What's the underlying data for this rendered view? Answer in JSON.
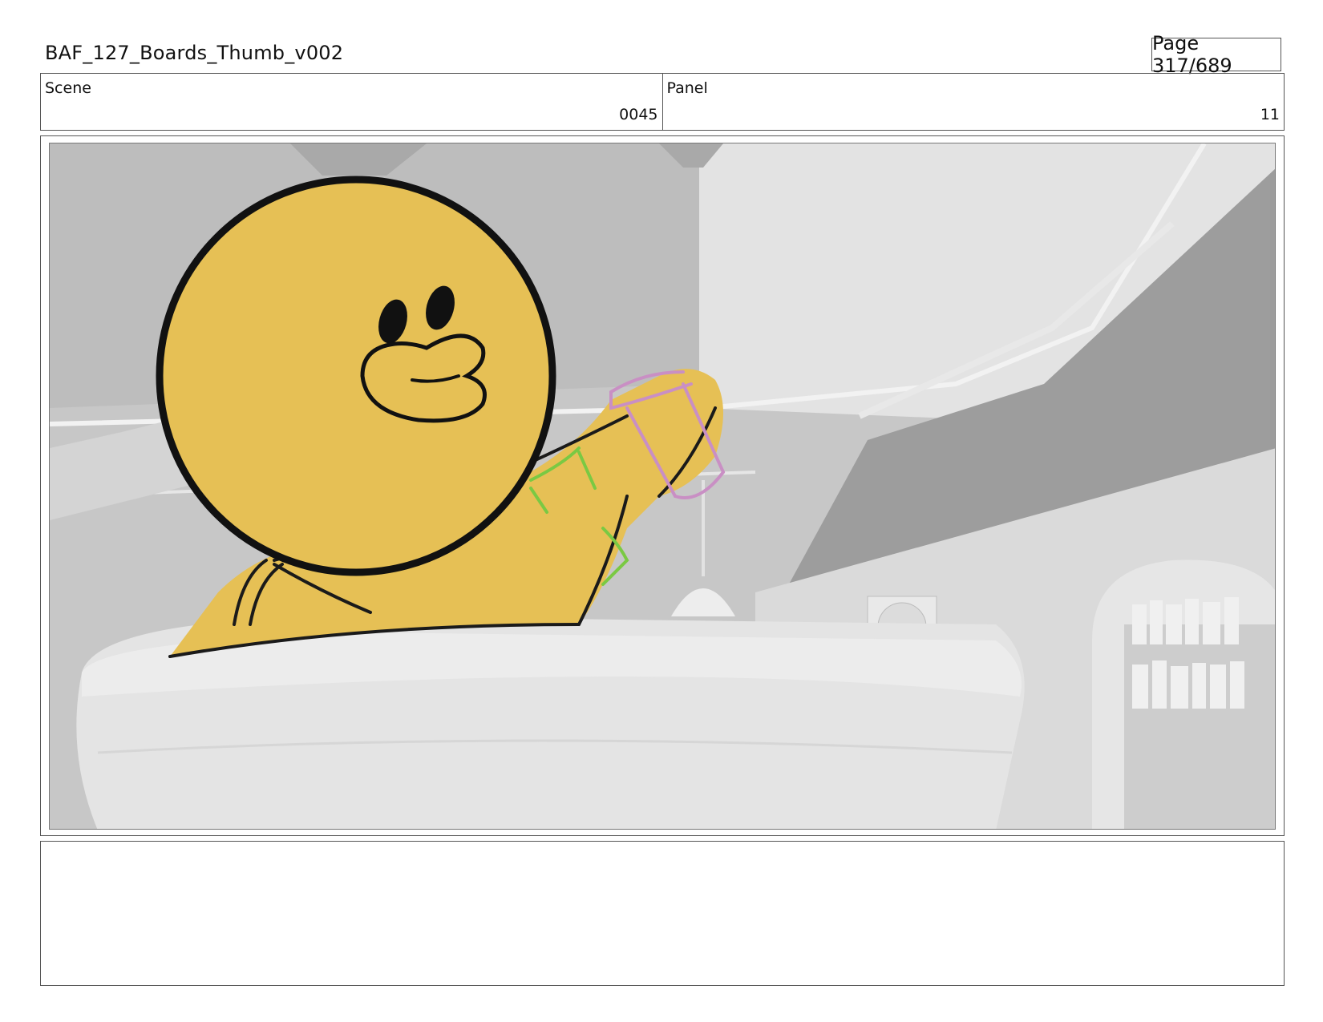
{
  "header": {
    "title": "BAF_127_Boards_Thumb_v002",
    "page": "Page 317/689"
  },
  "info": {
    "scene_label": "Scene",
    "scene_value": "0045",
    "panel_label": "Panel",
    "panel_value": "11"
  },
  "notes": {
    "text": ""
  },
  "colors": {
    "character": "#e6c055",
    "outline": "#111111",
    "green_sketch": "#7ac943",
    "pink_sketch": "#c98fc4",
    "background_gray": "#cfcfcf"
  }
}
